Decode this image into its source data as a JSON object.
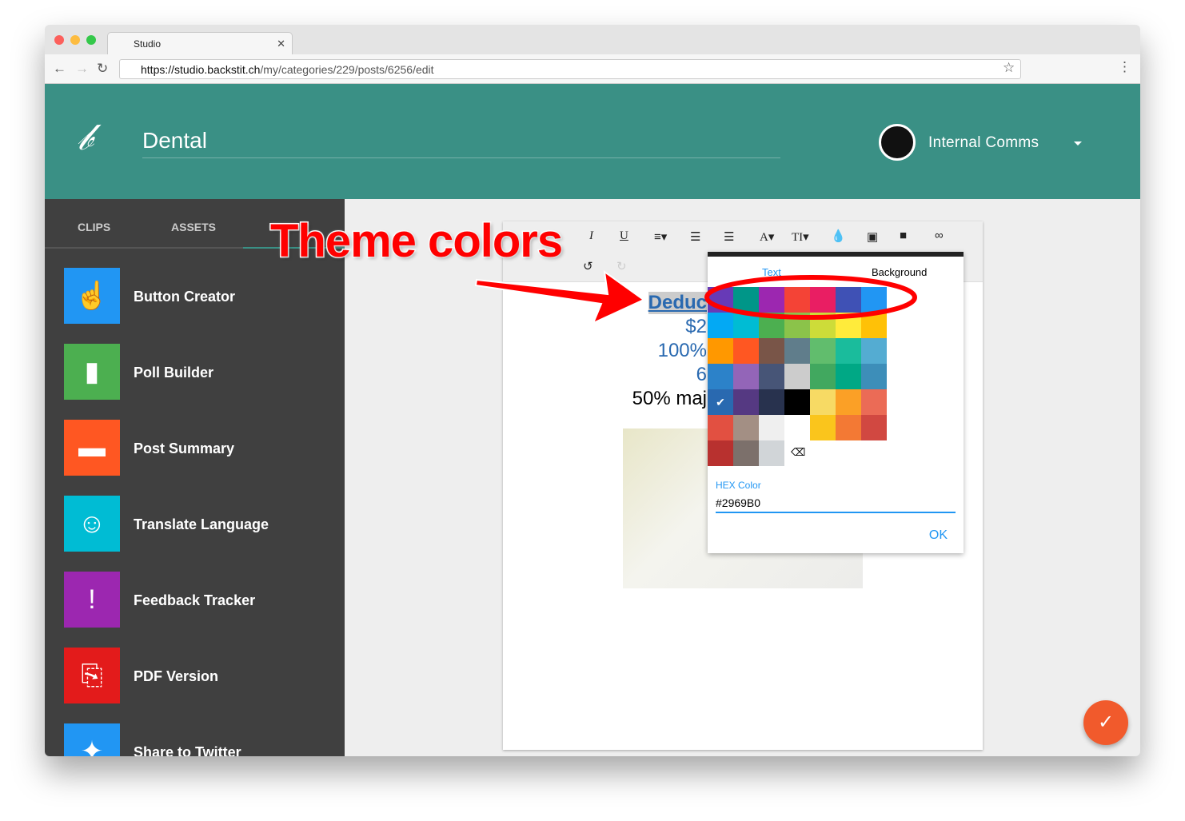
{
  "browser": {
    "tab_title": "Studio",
    "url_host": "https://studio.backstit.ch",
    "url_path": "/my/categories/229/posts/6256/edit"
  },
  "header": {
    "brand": "Dental",
    "organization": "Internal Comms"
  },
  "sidebar": {
    "tabs": [
      "CLIPS",
      "ASSETS"
    ],
    "items": [
      {
        "label": "Button Creator",
        "icon": "hand-pointer-icon",
        "color": "#2196f3"
      },
      {
        "label": "Poll Builder",
        "icon": "bar-chart-icon",
        "color": "#4caf50"
      },
      {
        "label": "Post Summary",
        "icon": "couch-icon",
        "color": "#ff5722"
      },
      {
        "label": "Translate Language",
        "icon": "speaker-icon",
        "color": "#00bcd4"
      },
      {
        "label": "Feedback Tracker",
        "icon": "exclamation-chat-icon",
        "color": "#9c27b0"
      },
      {
        "label": "PDF Version",
        "icon": "pdf-icon",
        "color": "#e31b1b"
      },
      {
        "label": "Share to Twitter",
        "icon": "twitter-icon",
        "color": "#2196f3"
      }
    ]
  },
  "editor": {
    "lines": [
      "Deduc",
      "$2",
      "100%",
      "6",
      "50% maj"
    ]
  },
  "color_picker": {
    "tabs": [
      "Text",
      "Background"
    ],
    "active_tab": "Text",
    "hex_label": "HEX Color",
    "hex_value": "#2969B0",
    "ok_label": "OK",
    "selected": "#2969B0",
    "colors": [
      [
        "#673AB7",
        "#009688",
        "#9C27B0",
        "#F44336",
        "#E91E63",
        "#3F51B5",
        "#2196F3"
      ],
      [
        "#03A9F4",
        "#00BCD4",
        "#4CAF50",
        "#8BC34A",
        "#CDDC39",
        "#FFEB3B",
        "#FFC107"
      ],
      [
        "#FF9800",
        "#FF5722",
        "#795548",
        "#607D8B",
        "#61BD6D",
        "#1ABC9C",
        "#54ACD2"
      ],
      [
        "#2C82C9",
        "#9365B8",
        "#475577",
        "#CCCCCC",
        "#41A85F",
        "#00A885",
        "#3D8EB9"
      ],
      [
        "#2969B0",
        "#553982",
        "#28324E",
        "#000000",
        "#F7DA64",
        "#FBA026",
        "#EB6B56"
      ],
      [
        "#E25041",
        "#A38F84",
        "#EFEFEF",
        "#FFFFFF",
        "#FAC51C",
        "#F37934",
        "#D14841"
      ],
      [
        "#B8312F",
        "#7C706B",
        "#D1D5D8"
      ]
    ]
  },
  "annotation": {
    "text": "Theme colors"
  }
}
